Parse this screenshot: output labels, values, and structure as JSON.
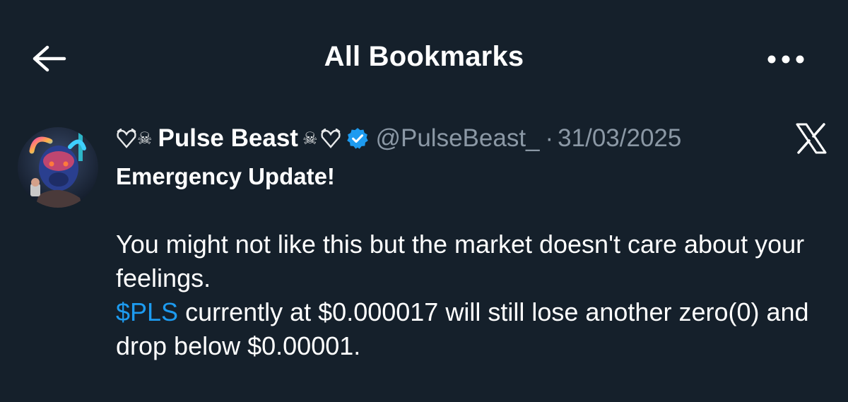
{
  "header": {
    "title": "All Bookmarks",
    "back_icon": "arrow-left-icon",
    "more_icon": "ellipsis-icon"
  },
  "tweet": {
    "author": {
      "name_prefix_glyphs": "☠",
      "name": "Pulse Beast",
      "name_suffix_glyphs": "☠",
      "handle": "@PulseBeast_",
      "separator": "·",
      "verified": true,
      "avatar_icon": "bull-avatar"
    },
    "date": "31/03/2025",
    "platform_icon": "x-logo-icon",
    "headline": "Emergency Update!",
    "body_line_1": "You might not like this but the market doesn't care about your feelings.",
    "cashtag": "$PLS",
    "body_line_2_rest": " currently at $0.000017 will still lose another zero(0) and drop below $0.00001."
  },
  "colors": {
    "background": "#15202b",
    "text": "#ffffff",
    "muted": "#8b98a5",
    "accent": "#1d9bf0"
  }
}
